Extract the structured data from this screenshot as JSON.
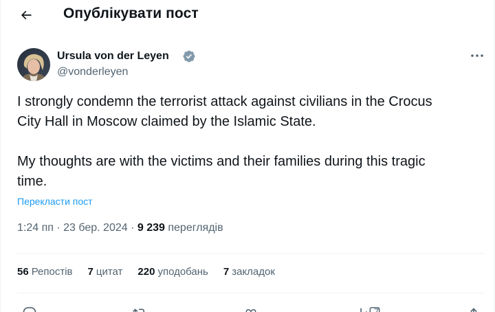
{
  "header": {
    "title": "Опублікувати пост",
    "back_icon": "arrow-left-icon"
  },
  "post": {
    "author_name": "Ursula von der Leyen",
    "author_handle": "@vonderleyen",
    "verified_icon": "verified-badge-icon",
    "verified_color": "#829aab",
    "paragraphs": [
      "I strongly condemn the terrorist attack against civilians in the Crocus\nCity Hall in Moscow claimed by the Islamic State.",
      "My thoughts are with the victims and their families during this tragic\ntime."
    ],
    "translate_label": "Перекласти пост",
    "time": "1:24 пп · 23 бер. 2024 · ",
    "views_count": "9 239",
    "views_label": "переглядів"
  },
  "stats": [
    {
      "count": "56",
      "label": "Репостів"
    },
    {
      "count": "7",
      "label": "цитат"
    },
    {
      "count": "220",
      "label": "уподобань"
    },
    {
      "count": "7",
      "label": "закладок"
    }
  ],
  "actions": {
    "bookmark_count": "7"
  },
  "colors": {
    "text": "#0f1419",
    "secondary": "#536471",
    "link": "#1d9bf0",
    "border": "#eff3f4"
  }
}
